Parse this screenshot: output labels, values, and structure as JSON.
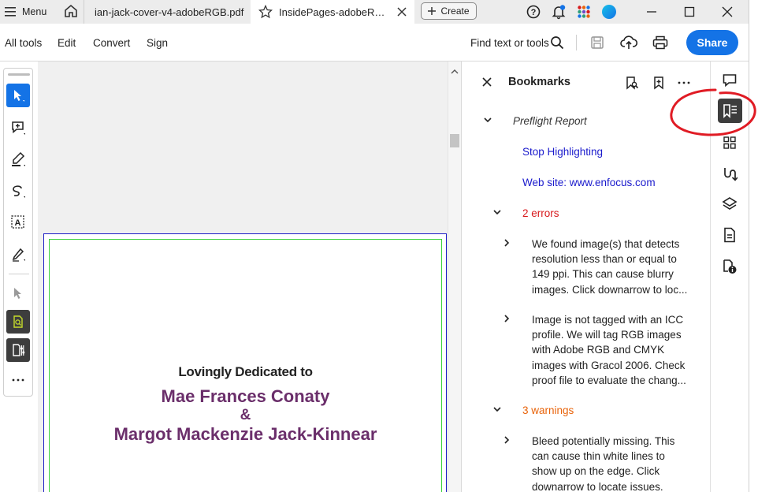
{
  "titlebar": {
    "menu_label": "Menu",
    "tabs": [
      {
        "label": "ian-jack-cover-v4-adobeRGB.pdf"
      },
      {
        "label": "InsidePages-adobeRGB.pdf"
      }
    ],
    "create_label": "Create"
  },
  "toolbar": {
    "items": [
      "All tools",
      "Edit",
      "Convert",
      "Sign"
    ],
    "find_label": "Find text or tools",
    "share_label": "Share"
  },
  "document": {
    "line1": "Lovingly Dedicated to",
    "line2": "Mae Frances Conaty",
    "line3": "&",
    "line4": "Margot Mackenzie Jack-Kinnear"
  },
  "bookmarks": {
    "title": "Bookmarks",
    "items": [
      {
        "label": "Preflight Report"
      },
      {
        "label": "Stop Highlighting"
      },
      {
        "label": "Web site: www.enfocus.com"
      },
      {
        "label": "2 errors"
      },
      {
        "line1": "We found image(s) that detects",
        "line2": "resolution less than or equal to",
        "line3": "149 ppi. This can cause blurry",
        "line4": "images. Click downarrow to loc..."
      },
      {
        "line1": "Image is not tagged with an ICC",
        "line2": "profile. We will tag RGB images",
        "line3": "with Adobe RGB and CMYK",
        "line4": "images with Gracol 2006. Check",
        "line5": "proof file to evaluate the chang..."
      },
      {
        "label": "3 warnings"
      },
      {
        "line1": "Bleed potentially missing. This",
        "line2": "can cause thin white lines to",
        "line3": "show up on the edge. Click",
        "line4": "downarrow to locate issues."
      }
    ]
  },
  "colors": {
    "accent": "#1473e6",
    "link_blue": "#1a1acc",
    "error_red": "#d7191c",
    "warning_orange": "#e8630a",
    "dedication_purple": "#6b2f6b",
    "annotation_red": "#e01b24"
  },
  "icons": [
    "hamburger-icon",
    "home-icon",
    "star-icon",
    "close-icon",
    "plus-icon",
    "help-icon",
    "bell-icon",
    "apps-icon",
    "profile-icon",
    "minimize-icon",
    "maximize-icon",
    "search-icon",
    "save-icon",
    "upload-icon",
    "print-icon"
  ]
}
